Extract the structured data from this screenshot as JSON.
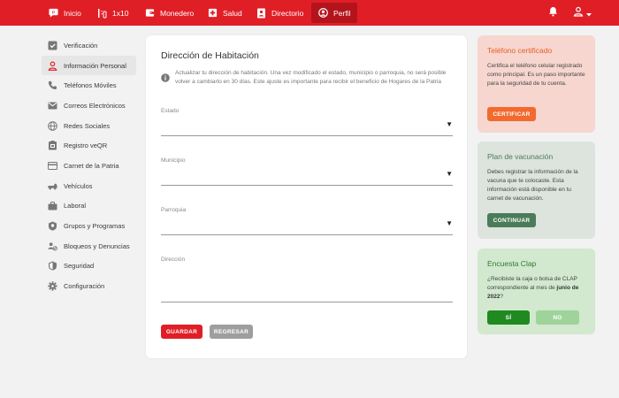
{
  "nav": {
    "items": [
      {
        "label": "Inicio",
        "icon": "chat-bubble-icon"
      },
      {
        "label": "1x10",
        "icon": "one-by-ten-icon"
      },
      {
        "label": "Monedero",
        "icon": "wallet-icon"
      },
      {
        "label": "Salud",
        "icon": "health-cross-icon"
      },
      {
        "label": "Directorio",
        "icon": "directory-icon"
      },
      {
        "label": "Perfil",
        "icon": "user-circle-icon"
      }
    ],
    "active": "Perfil",
    "color": "#e01e26"
  },
  "sidebar": {
    "items": [
      {
        "label": "Verificación",
        "icon": "check-square-icon"
      },
      {
        "label": "Información Personal",
        "icon": "person-icon"
      },
      {
        "label": "Teléfonos Móviles",
        "icon": "phone-icon"
      },
      {
        "label": "Correos Electrónicos",
        "icon": "mail-icon"
      },
      {
        "label": "Redes Sociales",
        "icon": "globe-icon"
      },
      {
        "label": "Registro veQR",
        "icon": "qr-register-icon"
      },
      {
        "label": "Carnet de la Patria",
        "icon": "card-icon"
      },
      {
        "label": "Vehículos",
        "icon": "car-icon"
      },
      {
        "label": "Laboral",
        "icon": "briefcase-icon"
      },
      {
        "label": "Grupos y Programas",
        "icon": "badge-icon"
      },
      {
        "label": "Bloqueos y Denuncias",
        "icon": "block-user-icon"
      },
      {
        "label": "Seguridad",
        "icon": "shield-icon"
      },
      {
        "label": "Configuración",
        "icon": "gear-icon"
      }
    ],
    "active": "Información Personal"
  },
  "main": {
    "title": "Dirección de Habitación",
    "info": "Actualizar tu dirección de habitación. Una vez modificado el estado, municipio o parroquia, no será posible volver a cambiarlo en 30 días. Este ajuste es importante para recibir el beneficio de Hogares de la Patria",
    "fields": {
      "estado": {
        "label": "Estado"
      },
      "municipio": {
        "label": "Municipio"
      },
      "parroquia": {
        "label": "Parroquia"
      },
      "direccion": {
        "label": "Dirección"
      }
    },
    "caret": "▼",
    "buttons": {
      "save": "GUARDAR",
      "back": "REGRESAR"
    }
  },
  "cards": {
    "phone": {
      "title": "Teléfono certificado",
      "body": "Certifica el teléfono celular registrado como principal. Es un paso importante para la seguridad de tu cuenta.",
      "button": "CERTIFICAR"
    },
    "vaccine": {
      "title": "Plan de vacunación",
      "body": "Debes registrar la información de la vacuna que te colocaste. Esta información está disponible en tu carnet de vacunación.",
      "button": "CONTINUAR"
    },
    "clap": {
      "title": "Encuesta Clap",
      "body_prefix": "¿Recibiste la caja o bolsa de CLAP correspondiente al mes de ",
      "body_bold": "junio de 2022",
      "body_suffix": "?",
      "yes": "SÍ",
      "no": "NO"
    }
  },
  "colors": {
    "primary_red": "#e01e26",
    "grey_button": "#9e9e9e",
    "phone_card_bg": "#f6d6cf",
    "phone_accent": "#f26a2e",
    "vaccine_card_bg": "#dde3dd",
    "vaccine_accent": "#4a7c59",
    "clap_card_bg": "#d2e8cf",
    "clap_yes": "#1f8a1f",
    "clap_no": "#9ed39a"
  }
}
